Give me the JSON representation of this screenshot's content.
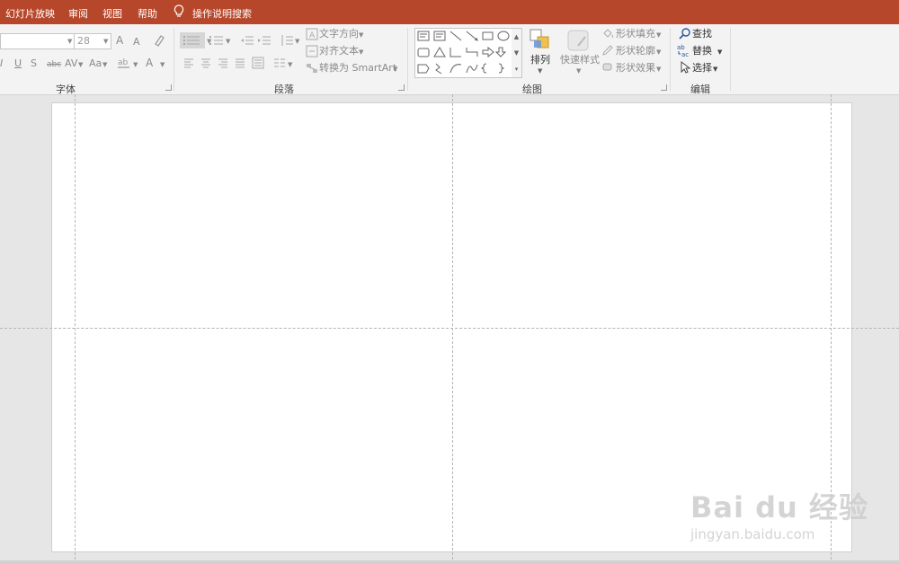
{
  "menubar": {
    "items": [
      "幻灯片放映",
      "审阅",
      "视图",
      "帮助"
    ],
    "search_label": "操作说明搜索",
    "color": "#b7472a"
  },
  "ribbon": {
    "font": {
      "label": "字体",
      "size_value": "28",
      "font_name_value": "",
      "grow_label": "A",
      "shrink_label": "A",
      "underline_label": "U",
      "strike_label": "S",
      "abc_label": "abc",
      "spacing_label": "AV",
      "case_label": "Aa",
      "color_label": "A",
      "italic_label": "I"
    },
    "paragraph": {
      "label": "段落",
      "text_direction": "文字方向",
      "align_text": "对齐文本",
      "convert_smartart": "转换为 SmartArt"
    },
    "drawing": {
      "label": "绘图",
      "arrange": "排列",
      "quick_styles": "快速样式",
      "shape_fill": "形状填充",
      "shape_outline": "形状轮廓",
      "shape_effects": "形状效果"
    },
    "editing": {
      "label": "编辑",
      "find": "查找",
      "replace": "替换",
      "select": "选择"
    }
  },
  "watermark": {
    "logo": "Bai du 经验",
    "url": "jingyan.baidu.com"
  },
  "icons": [
    "lightbulb-icon",
    "format-painter-icon",
    "bullets-icon",
    "numbering-icon",
    "decrease-indent-icon",
    "increase-indent-icon",
    "line-spacing-icon",
    "align-left-icon",
    "align-center-icon",
    "align-right-icon",
    "justify-icon",
    "distributed-icon",
    "columns-icon",
    "arrange-icon",
    "quick-styles-icon",
    "paint-bucket-icon",
    "pen-icon",
    "effects-icon",
    "search-icon",
    "replace-icon",
    "cursor-icon"
  ]
}
